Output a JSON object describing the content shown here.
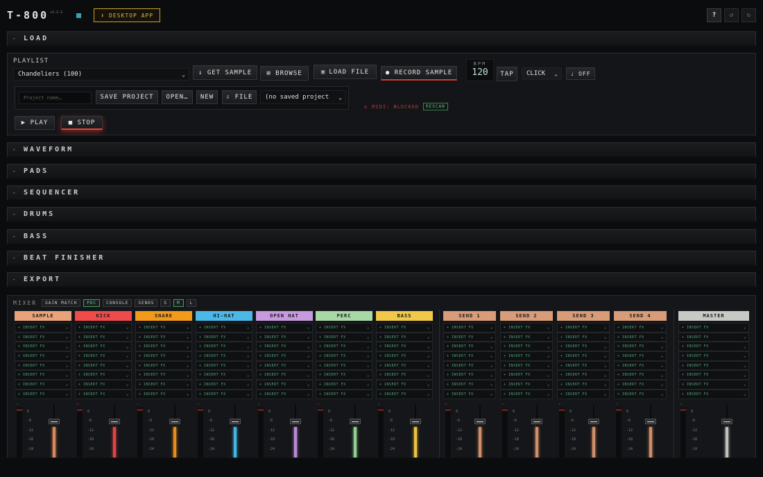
{
  "app": {
    "title": "T-800",
    "version": "v2.2.2",
    "desktop_label": "DESKTOP APP",
    "help": "?",
    "undo": "↺",
    "redo": "↻"
  },
  "sections": {
    "load": "LOAD",
    "waveform": "WAVEFORM",
    "pads": "PADS",
    "sequencer": "SEQUENCER",
    "drums": "DRUMS",
    "bass": "BASS",
    "beat_finisher": "BEAT FINISHER",
    "export": "EXPORT"
  },
  "load": {
    "playlist_label": "PLAYLIST",
    "playlist_value": "Chandeliers (100)",
    "get_sample": "↓ GET SAMPLE",
    "browse": "⊞ BROWSE",
    "load_file": "LOAD FILE",
    "record_sample": "● RECORD SAMPLE",
    "bpm_label": "BPM",
    "bpm_value": "120",
    "tap": "TAP",
    "click_value": "CLICK",
    "off": "♩ OFF",
    "project_placeholder": "Project name…",
    "save_project": "SAVE PROJECT",
    "open": "OPEN…",
    "new": "NEW",
    "file": "⇩ FILE",
    "saved_projects": "(no saved project",
    "midi_status": "MIDI: BLOCKED",
    "rescan": "RESCAN",
    "play": "▶ PLAY",
    "stop": "■ STOP"
  },
  "mixer": {
    "title": "MIXER",
    "gain_match": "GAIN MATCH",
    "pdc": "PDC",
    "console": "CONSOLE",
    "sends": "SENDS",
    "s": "S",
    "m": "M",
    "l": "L",
    "insert_label": "+ INSERT FX",
    "meter_tag": "◂◦",
    "scale": [
      "0",
      "-6",
      "-12",
      "-18",
      "-24"
    ],
    "channels": [
      {
        "name": "SAMPLE",
        "color": "#e8a37a",
        "fader": "#d68a58"
      },
      {
        "name": "KICK",
        "color": "#ef4b4b",
        "fader": "#e04444"
      },
      {
        "name": "SNARE",
        "color": "#f29a1a",
        "fader": "#e68c1c"
      },
      {
        "name": "HI-HAT",
        "color": "#4bb8e8",
        "fader": "#43b6e6"
      },
      {
        "name": "OPEN HAT",
        "color": "#c79ae0",
        "fader": "#bb8ad6"
      },
      {
        "name": "PERC",
        "color": "#a8d8a6",
        "fader": "#92cf93"
      },
      {
        "name": "BASS",
        "color": "#f1c84a",
        "fader": "#efc240"
      },
      {
        "name": "SEND 1",
        "color": "#d89c78",
        "fader": "#cf8f68"
      },
      {
        "name": "SEND 2",
        "color": "#d89c78",
        "fader": "#cf8f68"
      },
      {
        "name": "SEND 3",
        "color": "#d89c78",
        "fader": "#cf8f68"
      },
      {
        "name": "SEND 4",
        "color": "#d89c78",
        "fader": "#cf8f68"
      },
      {
        "name": "MASTER",
        "color": "#c8c8c4",
        "fader": "#c0c0bc"
      }
    ]
  }
}
